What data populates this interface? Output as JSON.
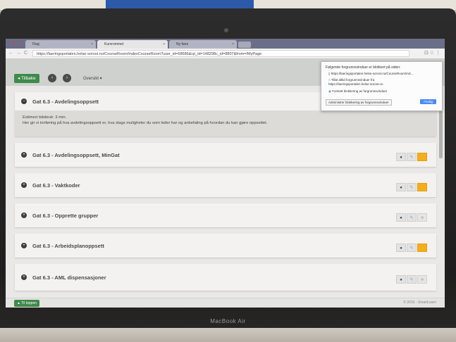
{
  "browser": {
    "tabs": [
      {
        "label": "Flag"
      },
      {
        "label": "Kursrommet"
      },
      {
        "label": "Ny fane"
      }
    ],
    "url": "https://laeringsportalen.helse-sorost.no/CourseRoom/IndexCourseRoom?user_id=68686&cp_id=148298c_id=8807&from=/MyPage"
  },
  "popup": {
    "title": "Følgende forgrunnsvinduer er blokkert på siden:",
    "blocked_url": "https://laeringsportalen.helse-sorost.no/CourseRoom/Ind...",
    "option_allow": "Tillat alltid forgrunnsvinduer fra https://laeringsportalen.helse-sorost.no",
    "option_block": "Fortsett blokkering av forgrunnsvinduer",
    "manage_label": "Administrer blokkering av forgrunnsvinduer",
    "done_label": "Ferdig"
  },
  "header": {
    "back_label": "Tilbake",
    "overview_label": "Oversikt",
    "right_letter": "T"
  },
  "sections": [
    {
      "title": "Gat 6.3 - Avdelingsoppsett",
      "expanded": true,
      "line1": "Estimert tidsbruk: 3 min.",
      "line2": "Her gir vi innføring på hva avdelingsoppsett er, hva slags muligheter du som leder har og anbefaling på hvordan du kan gjøre oppsettet."
    },
    {
      "title": "Gat 6.3 - Avdelingsoppsett, MinGat",
      "folder_active": true
    },
    {
      "title": "Gat 6.3 - Vaktkoder",
      "folder_active": true
    },
    {
      "title": "Gat 6.3 - Opprette grupper",
      "folder_active": false
    },
    {
      "title": "Gat 6.3 - Arbeidsplanoppsett",
      "folder_active": true
    },
    {
      "title": "Gat 6.3 - AML dispensasjoner",
      "folder_active": false
    }
  ],
  "footer": {
    "back_label": "Til toppen",
    "copyright": "© 2016 - SmartLearn"
  },
  "laptop_brand": "MacBook Air",
  "colors": {
    "accent_green": "#3f8a4b",
    "folder_orange": "#f3ad1e",
    "done_blue": "#4a8af4"
  }
}
